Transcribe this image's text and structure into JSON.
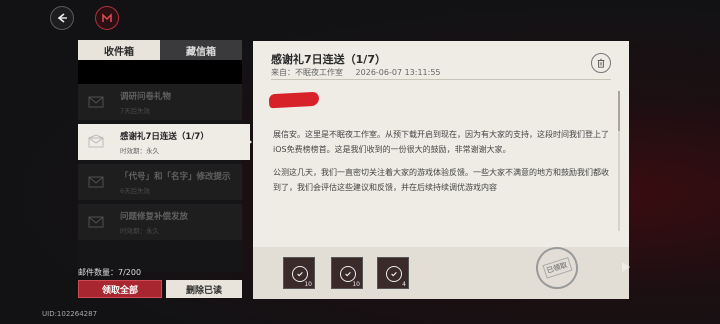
{
  "topbar": {
    "back_icon": "back-arrow-icon",
    "logo_icon": "game-logo-icon",
    "accent": "#b0303a"
  },
  "tabs": {
    "inbox_label": "收件箱",
    "favorites_label": "藏信箱"
  },
  "mail_list": [
    {
      "title": "调研问卷礼物",
      "sub": "7天后失效"
    },
    {
      "title": "感谢礼7日连送（1/7）",
      "sub": "时效期：永久"
    },
    {
      "title": "「代号」和「名字」修改提示",
      "sub": "6天后失效"
    },
    {
      "title": "问题修复补偿发放",
      "sub": "时效期：永久"
    }
  ],
  "footer": {
    "count_text": "邮件数量：7/200",
    "claim_all_label": "领取全部",
    "delete_read_label": "删除已读",
    "uid_text": "UID:102264287"
  },
  "detail": {
    "title": "感谢礼7日连送（1/7）",
    "sender": "来自：不眠夜工作室",
    "datetime": "2026-06-07 13:11:55",
    "body": [
      "展信安。这里是不眠夜工作室。从预下载开启到现在，因为有大家的支持，这段时间我们登上了iOS免费榜榜首。这是我们收到的一份很大的鼓励，非常谢谢大家。",
      "公测这几天，我们一直密切关注着大家的游戏体验反馈。一些大家不满意的地方和鼓励我们都收到了，我们会评估这些建议和反馈，并在后续持续调优游戏内容"
    ],
    "attachments": [
      {
        "qty": "10"
      },
      {
        "qty": "10"
      },
      {
        "qty": "4"
      }
    ],
    "stamp_text": "已领取"
  }
}
